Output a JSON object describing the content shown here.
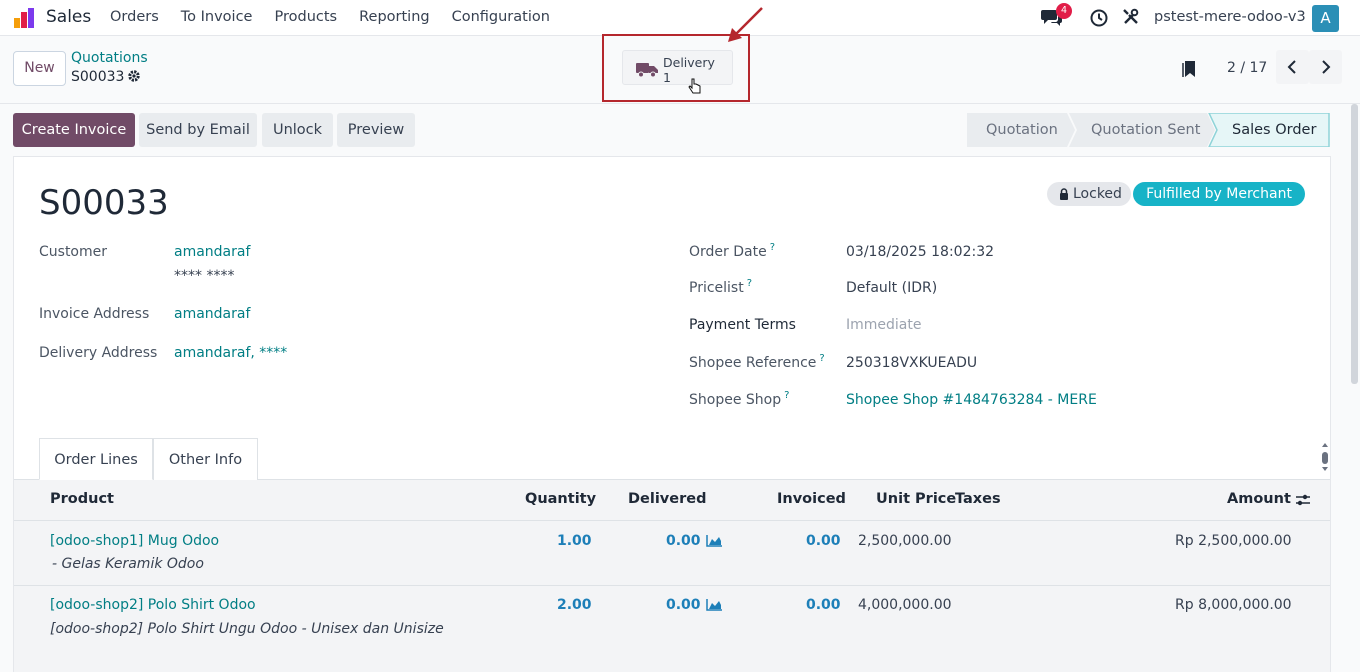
{
  "navbar": {
    "app_name": "Sales",
    "menu": [
      "Orders",
      "To Invoice",
      "Products",
      "Reporting",
      "Configuration"
    ],
    "chat_badge": "4",
    "db_name": "pstest-mere-odoo-v3",
    "avatar": "A"
  },
  "control": {
    "new_label": "New",
    "breadcrumb_parent": "Quotations",
    "breadcrumb_current": "S00033",
    "smart_button": {
      "label": "Delivery",
      "value": "1"
    },
    "pager": "2 / 17"
  },
  "actions": {
    "create_invoice": "Create Invoice",
    "send_email": "Send by Email",
    "unlock": "Unlock",
    "preview": "Preview"
  },
  "status": {
    "stages": [
      "Quotation",
      "Quotation Sent",
      "Sales Order"
    ],
    "active": "Sales Order"
  },
  "colors": {
    "primary": "#714b67",
    "link": "#017e84",
    "badge": "#17b3c7",
    "highlight_frame": "#b5272d"
  },
  "form": {
    "name": "S00033",
    "badge_locked": "Locked",
    "badge_fbm": "Fulfilled by Merchant",
    "left": {
      "customer_label": "Customer",
      "customer_value": "amandaraf",
      "customer_sub": "**** ****",
      "invoice_label": "Invoice Address",
      "invoice_value": "amandaraf",
      "delivery_label": "Delivery Address",
      "delivery_value": "amandaraf, ****"
    },
    "right": {
      "order_date_label": "Order Date",
      "order_date_value": "03/18/2025 18:02:32",
      "pricelist_label": "Pricelist",
      "pricelist_value": "Default (IDR)",
      "payment_terms_label": "Payment Terms",
      "payment_terms_value": "Immediate",
      "shopee_ref_label": "Shopee Reference",
      "shopee_ref_value": "250318VXKUEADU",
      "shopee_shop_label": "Shopee Shop",
      "shopee_shop_value": "Shopee Shop #1484763284 - MERE"
    }
  },
  "tabs": [
    "Order Lines",
    "Other Info"
  ],
  "table": {
    "headers": {
      "product": "Product",
      "quantity": "Quantity",
      "delivered": "Delivered",
      "invoiced": "Invoiced",
      "unit_price": "Unit Price",
      "taxes": "Taxes",
      "amount": "Amount"
    },
    "rows": [
      {
        "product": "[odoo-shop1] Mug Odoo",
        "description": "- Gelas Keramik Odoo",
        "quantity": "1.00",
        "delivered": "0.00",
        "invoiced": "0.00",
        "unit_price": "2,500,000.00",
        "amount": "Rp 2,500,000.00"
      },
      {
        "product": "[odoo-shop2] Polo Shirt Odoo",
        "description": "[odoo-shop2] Polo Shirt Ungu Odoo - Unisex dan Unisize",
        "quantity": "2.00",
        "delivered": "0.00",
        "invoiced": "0.00",
        "unit_price": "4,000,000.00",
        "amount": "Rp 8,000,000.00"
      }
    ]
  }
}
